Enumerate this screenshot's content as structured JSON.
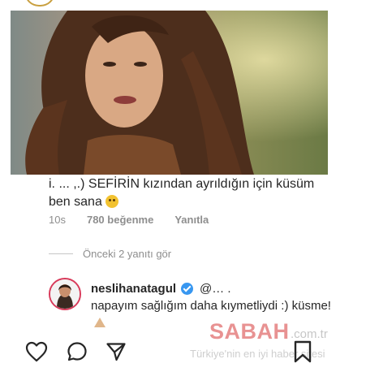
{
  "photo": {
    "icon": "portrait-photo"
  },
  "comment": {
    "text": "і. ... ,.) SEFİRİN kızından ayrıldığın için küsüm ben sana",
    "emoji": "pleading-face-emoji"
  },
  "meta": {
    "time": "10s",
    "likes": "780 beğenme",
    "reply": "Yanıtla"
  },
  "replies_toggle": "Önceki 2 yanıtı gör",
  "reply": {
    "username": "neslihanatagul",
    "mention": "@…           .",
    "text": "napayım sağlığım daha kıymetliydi :) küsme!",
    "emoji": "folded-hands-emoji"
  },
  "watermark": {
    "brand": "SABAH",
    "domain": ".com.tr",
    "tagline": "Türkiye'nin en iyi haber sitesi"
  },
  "actions": [
    "heart-icon",
    "comment-icon",
    "share-icon",
    "bookmark-icon"
  ],
  "colors": {
    "verified": "#3897f0",
    "story_ring": "#d83a5a",
    "brand": "#d63838"
  }
}
